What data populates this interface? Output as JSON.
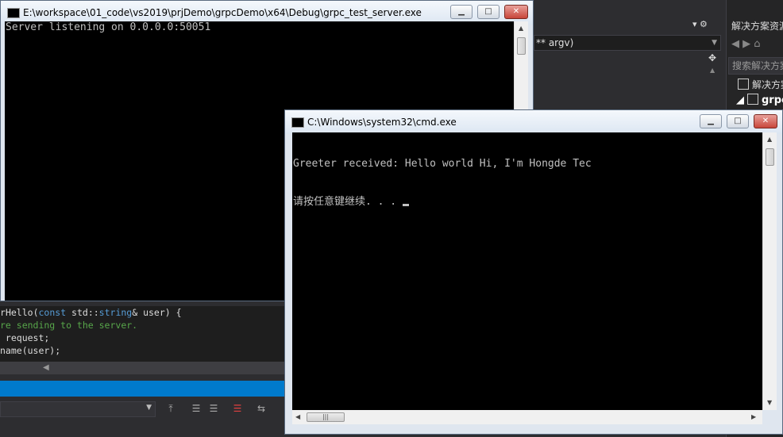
{
  "vs": {
    "function_bar": "** argv)",
    "solution_explorer": {
      "title": "解决方案资源管理器",
      "search_placeholder": "搜索解决方案资源管理器",
      "item_solution": "解决方案",
      "item_project": "grpc"
    },
    "code_lines": [
      {
        "a": "r",
        "b": "Hello",
        "c": "(",
        "d": "const",
        "e": " std::",
        "f": "string",
        "g": "& user) {"
      },
      {
        "comment": "re sending to the server."
      },
      {
        "text": " request;"
      },
      {
        "text": "name(user);"
      }
    ]
  },
  "server_window": {
    "title": "E:\\workspace\\01_code\\vs2019\\prjDemo\\grpcDemo\\x64\\Debug\\grpc_test_server.exe",
    "lines": [
      "Server listening on 0.0.0.0:50051"
    ],
    "minimize": "▁",
    "maximize": "□",
    "close": "✕"
  },
  "cmd_window": {
    "title": "C:\\Windows\\system32\\cmd.exe",
    "lines": [
      "Greeter received: Hello world Hi, I'm Hongde Tec",
      "请按任意键继续. . . "
    ],
    "minimize": "▁",
    "maximize": "□",
    "close": "✕"
  }
}
